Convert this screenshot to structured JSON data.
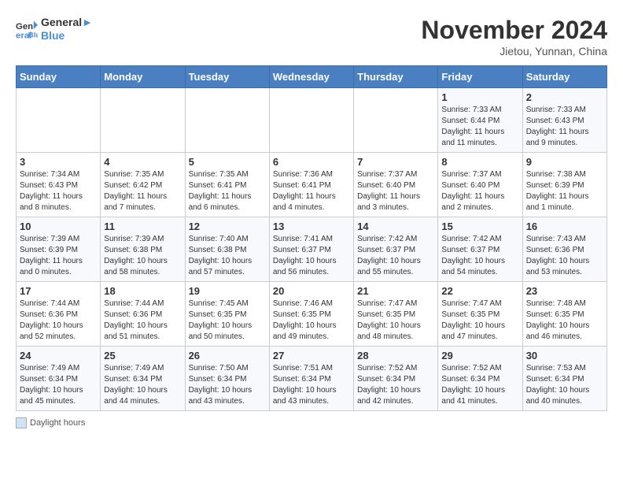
{
  "header": {
    "logo_line1": "General",
    "logo_line2": "Blue",
    "month_title": "November 2024",
    "location": "Jietou, Yunnan, China"
  },
  "weekdays": [
    "Sunday",
    "Monday",
    "Tuesday",
    "Wednesday",
    "Thursday",
    "Friday",
    "Saturday"
  ],
  "weeks": [
    [
      {
        "day": "",
        "info": ""
      },
      {
        "day": "",
        "info": ""
      },
      {
        "day": "",
        "info": ""
      },
      {
        "day": "",
        "info": ""
      },
      {
        "day": "",
        "info": ""
      },
      {
        "day": "1",
        "info": "Sunrise: 7:33 AM\nSunset: 6:44 PM\nDaylight: 11 hours and 11 minutes."
      },
      {
        "day": "2",
        "info": "Sunrise: 7:33 AM\nSunset: 6:43 PM\nDaylight: 11 hours and 9 minutes."
      }
    ],
    [
      {
        "day": "3",
        "info": "Sunrise: 7:34 AM\nSunset: 6:43 PM\nDaylight: 11 hours and 8 minutes."
      },
      {
        "day": "4",
        "info": "Sunrise: 7:35 AM\nSunset: 6:42 PM\nDaylight: 11 hours and 7 minutes."
      },
      {
        "day": "5",
        "info": "Sunrise: 7:35 AM\nSunset: 6:41 PM\nDaylight: 11 hours and 6 minutes."
      },
      {
        "day": "6",
        "info": "Sunrise: 7:36 AM\nSunset: 6:41 PM\nDaylight: 11 hours and 4 minutes."
      },
      {
        "day": "7",
        "info": "Sunrise: 7:37 AM\nSunset: 6:40 PM\nDaylight: 11 hours and 3 minutes."
      },
      {
        "day": "8",
        "info": "Sunrise: 7:37 AM\nSunset: 6:40 PM\nDaylight: 11 hours and 2 minutes."
      },
      {
        "day": "9",
        "info": "Sunrise: 7:38 AM\nSunset: 6:39 PM\nDaylight: 11 hours and 1 minute."
      }
    ],
    [
      {
        "day": "10",
        "info": "Sunrise: 7:39 AM\nSunset: 6:39 PM\nDaylight: 11 hours and 0 minutes."
      },
      {
        "day": "11",
        "info": "Sunrise: 7:39 AM\nSunset: 6:38 PM\nDaylight: 10 hours and 58 minutes."
      },
      {
        "day": "12",
        "info": "Sunrise: 7:40 AM\nSunset: 6:38 PM\nDaylight: 10 hours and 57 minutes."
      },
      {
        "day": "13",
        "info": "Sunrise: 7:41 AM\nSunset: 6:37 PM\nDaylight: 10 hours and 56 minutes."
      },
      {
        "day": "14",
        "info": "Sunrise: 7:42 AM\nSunset: 6:37 PM\nDaylight: 10 hours and 55 minutes."
      },
      {
        "day": "15",
        "info": "Sunrise: 7:42 AM\nSunset: 6:37 PM\nDaylight: 10 hours and 54 minutes."
      },
      {
        "day": "16",
        "info": "Sunrise: 7:43 AM\nSunset: 6:36 PM\nDaylight: 10 hours and 53 minutes."
      }
    ],
    [
      {
        "day": "17",
        "info": "Sunrise: 7:44 AM\nSunset: 6:36 PM\nDaylight: 10 hours and 52 minutes."
      },
      {
        "day": "18",
        "info": "Sunrise: 7:44 AM\nSunset: 6:36 PM\nDaylight: 10 hours and 51 minutes."
      },
      {
        "day": "19",
        "info": "Sunrise: 7:45 AM\nSunset: 6:35 PM\nDaylight: 10 hours and 50 minutes."
      },
      {
        "day": "20",
        "info": "Sunrise: 7:46 AM\nSunset: 6:35 PM\nDaylight: 10 hours and 49 minutes."
      },
      {
        "day": "21",
        "info": "Sunrise: 7:47 AM\nSunset: 6:35 PM\nDaylight: 10 hours and 48 minutes."
      },
      {
        "day": "22",
        "info": "Sunrise: 7:47 AM\nSunset: 6:35 PM\nDaylight: 10 hours and 47 minutes."
      },
      {
        "day": "23",
        "info": "Sunrise: 7:48 AM\nSunset: 6:35 PM\nDaylight: 10 hours and 46 minutes."
      }
    ],
    [
      {
        "day": "24",
        "info": "Sunrise: 7:49 AM\nSunset: 6:34 PM\nDaylight: 10 hours and 45 minutes."
      },
      {
        "day": "25",
        "info": "Sunrise: 7:49 AM\nSunset: 6:34 PM\nDaylight: 10 hours and 44 minutes."
      },
      {
        "day": "26",
        "info": "Sunrise: 7:50 AM\nSunset: 6:34 PM\nDaylight: 10 hours and 43 minutes."
      },
      {
        "day": "27",
        "info": "Sunrise: 7:51 AM\nSunset: 6:34 PM\nDaylight: 10 hours and 43 minutes."
      },
      {
        "day": "28",
        "info": "Sunrise: 7:52 AM\nSunset: 6:34 PM\nDaylight: 10 hours and 42 minutes."
      },
      {
        "day": "29",
        "info": "Sunrise: 7:52 AM\nSunset: 6:34 PM\nDaylight: 10 hours and 41 minutes."
      },
      {
        "day": "30",
        "info": "Sunrise: 7:53 AM\nSunset: 6:34 PM\nDaylight: 10 hours and 40 minutes."
      }
    ]
  ],
  "footer": {
    "daylight_label": "Daylight hours"
  }
}
